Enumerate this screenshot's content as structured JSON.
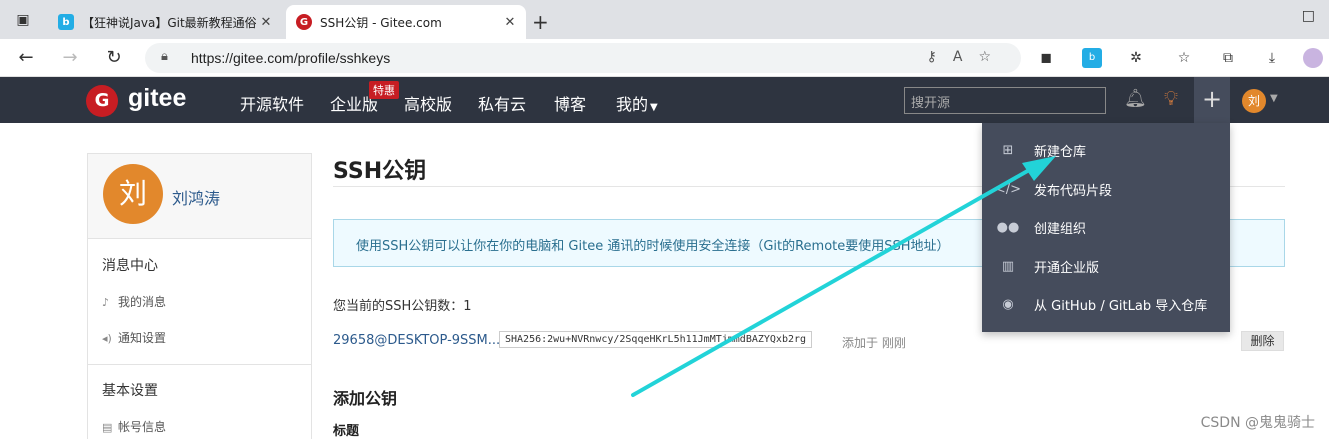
{
  "browser": {
    "tabs": [
      {
        "title": "【狂神说Java】Git最新教程通俗易懂",
        "close": "✕"
      },
      {
        "title": "SSH公钥 - Gitee.com",
        "close": "✕"
      }
    ],
    "url": "https://gitee.com/profile/sshkeys"
  },
  "header": {
    "logo_letter": "G",
    "brand": "gitee",
    "nav": [
      "开源软件",
      "企业版",
      "高校版",
      "私有云",
      "博客",
      "我的"
    ],
    "hot_badge": "特惠",
    "search_placeholder": "搜开源",
    "avatar_letter": "刘"
  },
  "dropdown": {
    "items": [
      {
        "label": "新建仓库",
        "icon": "plus-square-icon"
      },
      {
        "label": "发布代码片段",
        "icon": "code-icon"
      },
      {
        "label": "创建组织",
        "icon": "users-icon"
      },
      {
        "label": "开通企业版",
        "icon": "building-icon"
      },
      {
        "label": "从 GitHub / GitLab 导入仓库",
        "icon": "github-icon"
      }
    ]
  },
  "sidebar": {
    "avatar_letter": "刘",
    "username": "刘鸿涛",
    "sections": [
      {
        "title": "消息中心",
        "items": [
          "我的消息",
          "通知设置"
        ]
      },
      {
        "title": "基本设置",
        "items": [
          "帐号信息"
        ]
      }
    ]
  },
  "main": {
    "title": "SSH公钥",
    "info": "使用SSH公钥可以让你在你的电脑和 Gitee 通讯的时候使用安全连接（Git的Remote要使用SSH地址）",
    "count_text": "您当前的SSH公钥数：1",
    "key": {
      "name": "29658@DESKTOP-9SSM...",
      "fingerprint": "SHA256:2wu+NVRnwcy/2SqqeHKrL5h11JmMTjmmdBAZYQxb2rg",
      "added": "添加于 刚刚",
      "delete": "删除"
    },
    "add_title": "添加公钥",
    "field_label": "标题"
  },
  "watermark": "CSDN @鬼鬼骑士",
  "colors": {
    "header_bg": "#2e3440",
    "dropdown_bg": "#454c5c",
    "brand_red": "#c71d23",
    "avatar_orange": "#e2882c",
    "arrow_cyan": "#22d3d8"
  }
}
